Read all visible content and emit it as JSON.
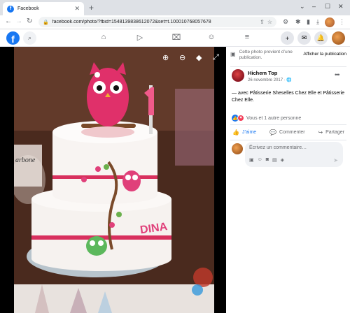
{
  "browser": {
    "tab_title": "Facebook",
    "favicon_letter": "f",
    "close_glyph": "✕",
    "new_tab_glyph": "+",
    "url": "facebook.com/photo/?fbid=1548139838612072&set=t.100010768057678",
    "window_controls": [
      "⌄",
      "–",
      "☐",
      "✕"
    ]
  },
  "facebook_header": {
    "logo_letter": "f",
    "nav_icons": [
      "home-icon",
      "watch-icon",
      "marketplace-icon",
      "groups-icon",
      "menu-icon"
    ]
  },
  "photo_viewer": {
    "tools": [
      "zoom-in-icon",
      "zoom-out-icon",
      "tag-icon",
      "fullscreen-icon"
    ],
    "cake_sign_text": "DINA"
  },
  "side_panel": {
    "notice_text": "Cette photo provient d’une publication.",
    "notice_button": "Afficher la publication",
    "author_name": "Hichem Top",
    "post_date": "26 novembre 2017 · ",
    "caption": "— avec Pâtisserie Sheselles Chez Elle et Pâtisserie Chez Elle.",
    "reactions_text": "Vous et 1 autre personne",
    "actions": {
      "like": "J’aime",
      "comment": "Commenter",
      "share": "Partager"
    },
    "comment_placeholder": "Écrivez un commentaire…"
  }
}
